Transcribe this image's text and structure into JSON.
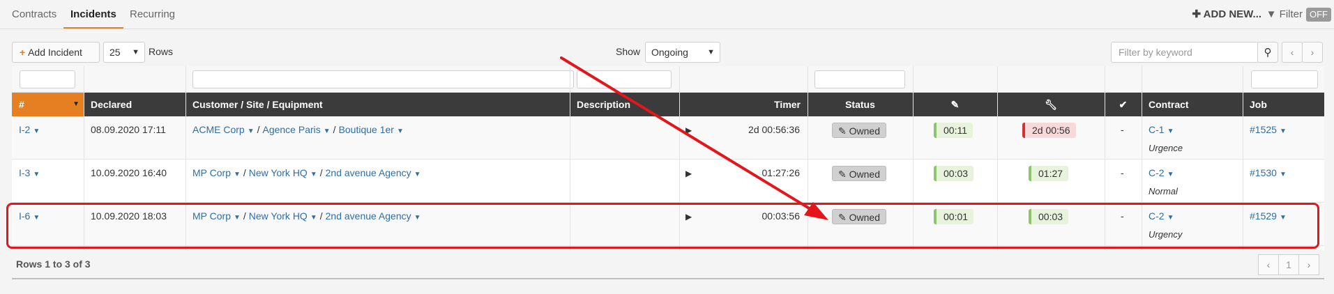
{
  "tabs": [
    "Contracts",
    "Incidents",
    "Recurring"
  ],
  "top_actions": {
    "add_new": "ADD NEW...",
    "filter": "Filter",
    "filter_state": "OFF"
  },
  "toolbar": {
    "add_incident": "Add Incident",
    "rows_value": "25",
    "rows_label": "Rows",
    "show_label": "Show",
    "show_value": "Ongoing",
    "search_placeholder": "Filter by keyword"
  },
  "columns": [
    "#",
    "Declared",
    "Customer / Site / Equipment",
    "Description",
    "Timer",
    "Status",
    "",
    "",
    "",
    "Contract",
    "Job"
  ],
  "rows": [
    {
      "id": "I-2",
      "declared": "08.09.2020 17:11",
      "customer": "ACME Corp",
      "site": "Agence Paris",
      "equipment": "Boutique 1er",
      "description": "",
      "timer": "2d 00:56:36",
      "status": "Owned",
      "edit_time": "00:11",
      "work_time": "2d 00:56",
      "check": "-",
      "contract": "C-1",
      "priority": "Urgence",
      "job": "#1525"
    },
    {
      "id": "I-3",
      "declared": "10.09.2020 16:40",
      "customer": "MP Corp",
      "site": "New York HQ",
      "equipment": "2nd avenue Agency",
      "description": "",
      "timer": "01:27:26",
      "status": "Owned",
      "edit_time": "00:03",
      "work_time": "01:27",
      "check": "-",
      "contract": "C-2",
      "priority": "Normal",
      "job": "#1530"
    },
    {
      "id": "I-6",
      "declared": "10.09.2020 18:03",
      "customer": "MP Corp",
      "site": "New York HQ",
      "equipment": "2nd avenue Agency",
      "description": "",
      "timer": "00:03:56",
      "status": "Owned",
      "edit_time": "00:01",
      "work_time": "00:03",
      "check": "-",
      "contract": "C-2",
      "priority": "Urgency",
      "job": "#1529"
    }
  ],
  "footer": {
    "summary": "Rows 1 to 3 of 3",
    "page": "1"
  },
  "colors": {
    "accent": "#e67e22",
    "header": "#3b3b3b",
    "link": "#2f6ea5",
    "annotation": "#e3161b",
    "green": "#8cc56b",
    "red": "#d8302f"
  }
}
